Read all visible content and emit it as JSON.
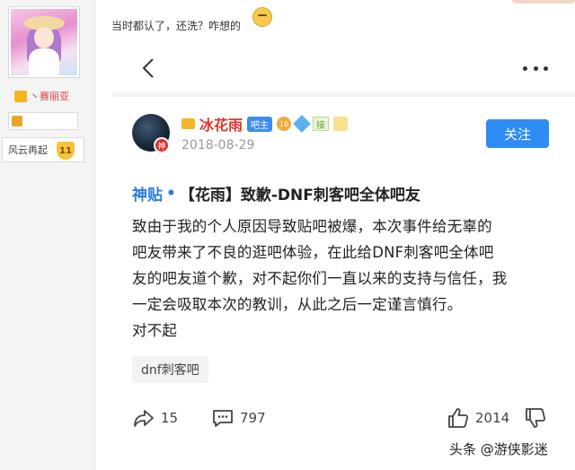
{
  "sidebar": {
    "username": "丶赛丽亚",
    "forum_name": "风云再起",
    "forum_level": "11"
  },
  "reply": {
    "text": "当时都认了，还洗？咋想的"
  },
  "post": {
    "author": {
      "name": "冰花雨",
      "role_badge": "吧主",
      "level": "16",
      "tag": "接",
      "avatar_badge": "神",
      "date": "2018-08-29"
    },
    "follow_label": "关注",
    "title_tag": "神贴",
    "title_dot": "•",
    "title": "【花雨】致歉-DNF刺客吧全体吧友",
    "body_lines": [
      "致由于我的个人原因导致贴吧被爆，本次事件给无辜的",
      "吧友带来了不良的逛吧体验，在此给DNF刺客吧全体吧",
      "友的吧友道个歉，对不起你们一直以来的支持与信任，我",
      "一定会吸取本次的教训，从此之后一定谨言慎行。",
      "对不起"
    ],
    "forum_tag": "dnf刺客吧",
    "stats": {
      "shares": "15",
      "comments": "797",
      "likes": "2014"
    }
  },
  "watermark": "头条 @游侠影迷",
  "colors": {
    "accent_blue": "#2e8cf2",
    "author_red": "#e0352b",
    "title_tag_blue": "#2e7be0"
  }
}
